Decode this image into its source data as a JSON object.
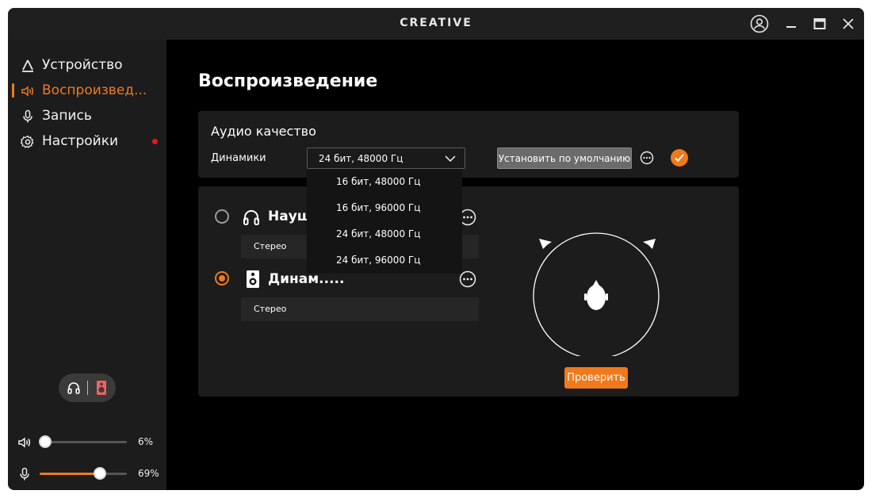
{
  "titlebar": {
    "brand": "CREATIVE"
  },
  "sidebar": {
    "items": [
      {
        "label": "Устройство",
        "icon": "device-icon"
      },
      {
        "label": "Воспроизвед...",
        "icon": "speaker-volume-icon",
        "active": true
      },
      {
        "label": "Запись",
        "icon": "microphone-icon"
      },
      {
        "label": "Настройки",
        "icon": "gear-icon",
        "badge": "red-dot"
      }
    ],
    "output_toggle": {
      "left_icon": "headphones-icon",
      "right_icon": "speaker-icon",
      "selected": "speaker"
    },
    "volume": {
      "icon": "speaker-volume-icon",
      "value_text": "6%",
      "value": 6
    },
    "mic": {
      "icon": "microphone-icon",
      "value_text": "69%",
      "value": 69
    }
  },
  "main": {
    "title": "Воспроизведение",
    "audio_quality": {
      "title": "Аудио качество",
      "label": "Динамики",
      "selected": "24 бит, 48000 Гц",
      "default_button": "Установить по умолчанию",
      "options": [
        "16 бит, 48000 Гц",
        "16 бит, 96000 Гц",
        "24 бит, 48000 Гц",
        "24 бит, 96000 Гц"
      ]
    },
    "devices": [
      {
        "name": "Наушн",
        "icon": "headphones-icon",
        "mode": "Стерео",
        "selected": false
      },
      {
        "name": "Динам.....",
        "icon": "speaker-icon",
        "mode": "Стерео",
        "selected": true
      }
    ],
    "test_button": "Проверить"
  },
  "colors": {
    "accent": "#f07a1b",
    "background": "#000000",
    "panel": "#1c1c1c",
    "badge": "#e01b1b"
  }
}
